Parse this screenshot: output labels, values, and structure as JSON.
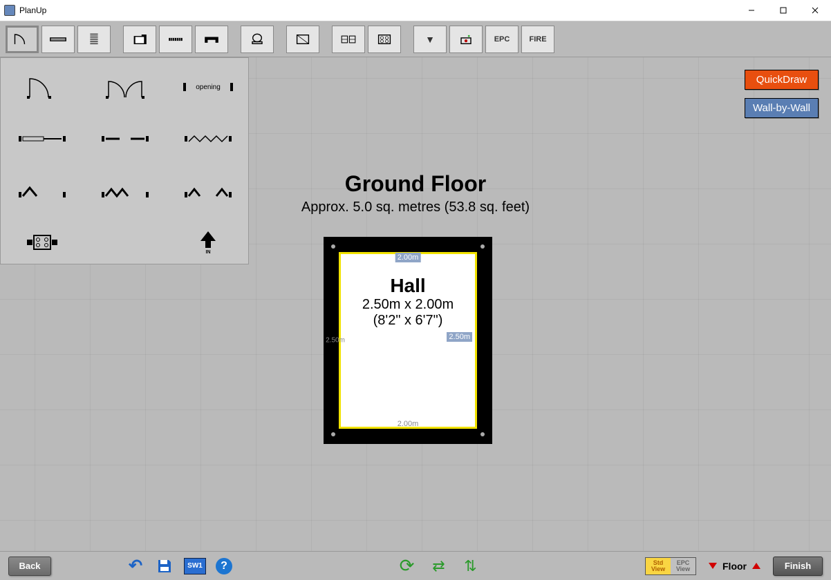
{
  "window": {
    "title": "PlanUp"
  },
  "toolbar": {
    "buttons": [
      {
        "name": "door-tool",
        "label": ""
      },
      {
        "name": "window-tool",
        "label": ""
      },
      {
        "name": "stairs-tool",
        "label": ""
      },
      {
        "name": "room-outline-tool",
        "label": ""
      },
      {
        "name": "grid-block-tool",
        "label": ""
      },
      {
        "name": "furniture-tool",
        "label": ""
      },
      {
        "name": "bath-tool",
        "label": ""
      },
      {
        "name": "panel-tool",
        "label": ""
      },
      {
        "name": "mirrored-tool",
        "label": ""
      },
      {
        "name": "hob-tool",
        "label": ""
      },
      {
        "name": "dropdown-more-tool",
        "label": "▼"
      },
      {
        "name": "camera-tool",
        "label": ""
      },
      {
        "name": "epc-tool",
        "label": "EPC"
      },
      {
        "name": "fire-tool",
        "label": "FIRE"
      }
    ]
  },
  "panel": {
    "opening_label": "opening",
    "in_label": "IN"
  },
  "modes": {
    "quickdraw": "QuickDraw",
    "wallbywall": "Wall-by-Wall"
  },
  "floor": {
    "title": "Ground Floor",
    "subtitle": "Approx. 5.0 sq. metres (53.8 sq. feet)"
  },
  "room": {
    "name": "Hall",
    "dims_metric": "2.50m x 2.00m",
    "dims_imperial": "(8'2\" x 6'7\")",
    "top": "2.00m",
    "bottom": "2.00m",
    "left": "2.50m",
    "right": "2.50m"
  },
  "bottombar": {
    "back": "Back",
    "sw_label": "SW1",
    "std": "Std",
    "view": "View",
    "epc": "EPC",
    "floor_label": "Floor",
    "finish": "Finish"
  }
}
